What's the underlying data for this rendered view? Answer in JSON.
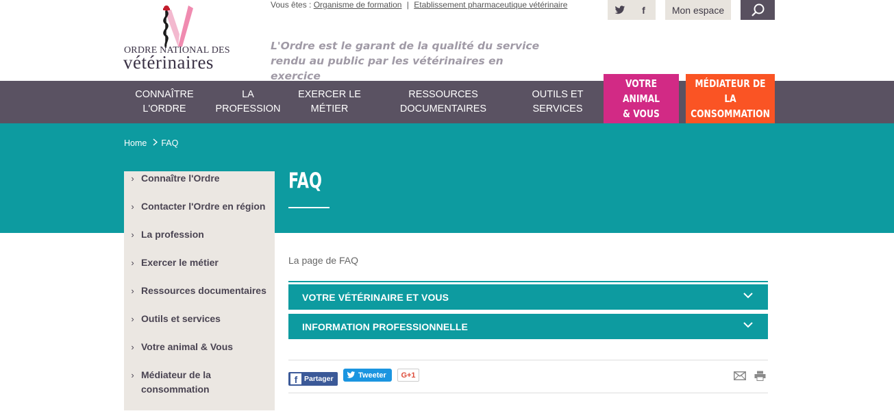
{
  "header": {
    "logo_line1": "ORDRE NATIONAL DES",
    "logo_line2": "vétérinaires",
    "vous_etes_label": "Vous êtes :",
    "vous_etes_links": [
      "Organisme de formation",
      "Etablissement pharmaceutique vétérinaire"
    ],
    "separator": "|",
    "tagline": "L'Ordre est le garant de la qualité du service rendu au public par les vétérinaires en exercice",
    "social_icons": [
      "twitter-icon",
      "facebook-icon"
    ],
    "social_glyphs": [
      "t",
      "f"
    ],
    "mon_espace": "Mon espace",
    "search_icon": "search-icon"
  },
  "nav": {
    "items": [
      {
        "label": "CONNAÎTRE\nL'ORDRE"
      },
      {
        "label": "LA\nPROFESSION"
      },
      {
        "label": "EXERCER LE\nMÉTIER"
      },
      {
        "label": "RESSOURCES\nDOCUMENTAIRES"
      },
      {
        "label": "OUTILS ET\nSERVICES"
      }
    ],
    "animal": "VOTRE ANIMAL\n& VOUS",
    "mediateur": "MÉDIATEUR DE LA\nCONSOMMATION",
    "colors": {
      "nav_bg": "#5a5262",
      "animal": "#d22a85",
      "mediateur": "#fa5424"
    }
  },
  "breadcrumb": {
    "home": "Home",
    "current": "FAQ"
  },
  "page": {
    "title": "FAQ",
    "intro": "La page de FAQ",
    "accent": "#0d9ba0"
  },
  "sidebar": {
    "items": [
      {
        "label": "Connaître l'Ordre"
      },
      {
        "label": "Contacter l'Ordre en région"
      },
      {
        "label": "La profession"
      },
      {
        "label": "Exercer le métier"
      },
      {
        "label": "Ressources documentaires"
      },
      {
        "label": "Outils et services"
      },
      {
        "label": "Votre animal & Vous"
      },
      {
        "label": "Médiateur de la consommation"
      }
    ]
  },
  "faq": {
    "sections": [
      {
        "label": "VOTRE VÉTÉRINAIRE ET VOUS"
      },
      {
        "label": "INFORMATION PROFESSIONNELLE"
      }
    ]
  },
  "share": {
    "facebook": "Partager",
    "twitter": "Tweeter",
    "gplus": "G+1",
    "icons": [
      "mail-icon",
      "print-icon"
    ]
  }
}
